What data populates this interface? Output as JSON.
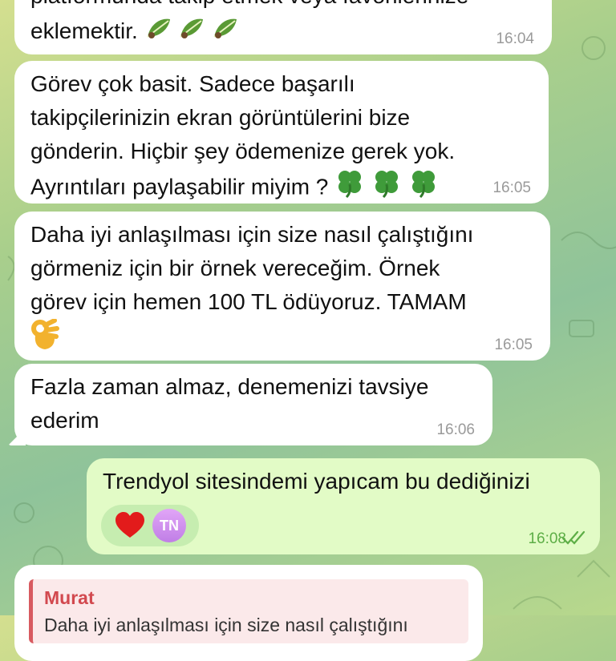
{
  "messages": [
    {
      "text_top": "platformunda takip etmek veya favorilerinize",
      "text": "eklemektir.",
      "emoji": [
        "leaf-icon",
        "leaf-icon",
        "leaf-icon"
      ],
      "time": "16:04",
      "direction": "incoming"
    },
    {
      "lines": [
        "Görev  çok  basit. Sadece başarılı",
        "takipçilerinizin ekran görüntülerini  bize",
        "gönderin. Hiçbir şey ödemenize gerek yok.",
        "Ayrıntıları  paylaşabilir  miyim ?"
      ],
      "emoji": [
        "four-leaf-clover-icon",
        "four-leaf-clover-icon",
        "four-leaf-clover-icon"
      ],
      "time": "16:05",
      "direction": "incoming"
    },
    {
      "lines": [
        "Daha iyi anlaşılması için size nasıl çalıştığını",
        "görmeniz için bir örnek vereceğim.   Örnek",
        "görev için hemen 100 TL ödüyoruz. TAMAM"
      ],
      "emoji": [
        "ok-hand-icon"
      ],
      "time": "16:05",
      "direction": "incoming"
    },
    {
      "lines": [
        "Fazla zaman almaz, denemenizi tavsiye",
        "ederim"
      ],
      "time": "16:06",
      "direction": "incoming"
    },
    {
      "text": "Trendyol sitesindemi yapıcam bu dediğinizi",
      "reactions": {
        "emoji": "heart-icon",
        "avatar_initials": "TN"
      },
      "time": "16:08",
      "status": "read",
      "direction": "outgoing"
    }
  ],
  "reply": {
    "sender": "Murat",
    "preview": "Daha iyi anlaşılması için size nasıl çalıştığını"
  },
  "colors": {
    "incoming_bubble": "#ffffff",
    "outgoing_bubble": "#e2fbc6",
    "outgoing_time": "#5dae46",
    "reply_accent": "#d2494f",
    "avatar": "#c98be9"
  }
}
